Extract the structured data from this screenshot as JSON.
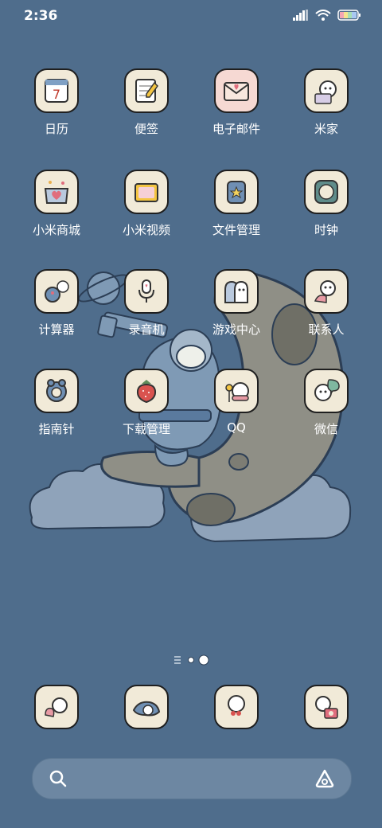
{
  "status_bar": {
    "time": "2:36"
  },
  "apps": [
    {
      "label": "日历",
      "icon": "calendar-icon",
      "badge": "7"
    },
    {
      "label": "便签",
      "icon": "notes-icon"
    },
    {
      "label": "电子邮件",
      "icon": "mail-icon"
    },
    {
      "label": "米家",
      "icon": "mijia-icon"
    },
    {
      "label": "小米商城",
      "icon": "shop-icon"
    },
    {
      "label": "小米视频",
      "icon": "video-icon"
    },
    {
      "label": "文件管理",
      "icon": "files-icon"
    },
    {
      "label": "时钟",
      "icon": "clock-icon"
    },
    {
      "label": "计算器",
      "icon": "calculator-icon"
    },
    {
      "label": "录音机",
      "icon": "recorder-icon"
    },
    {
      "label": "游戏中心",
      "icon": "game-center-icon"
    },
    {
      "label": "联系人",
      "icon": "contacts-icon"
    },
    {
      "label": "指南针",
      "icon": "compass-icon"
    },
    {
      "label": "下载管理",
      "icon": "download-icon"
    },
    {
      "label": "QQ",
      "icon": "qq-icon"
    },
    {
      "label": "微信",
      "icon": "wechat-icon"
    }
  ],
  "dock": [
    {
      "icon": "phone-icon"
    },
    {
      "icon": "messages-icon"
    },
    {
      "icon": "browser-icon"
    },
    {
      "icon": "camera-icon"
    }
  ],
  "page_indicator": {
    "pages": 2,
    "current": 2
  },
  "colors": {
    "background": "#4f6d8c",
    "icon_bg": "#f1ead8",
    "search_bar": "#6d87a2"
  }
}
